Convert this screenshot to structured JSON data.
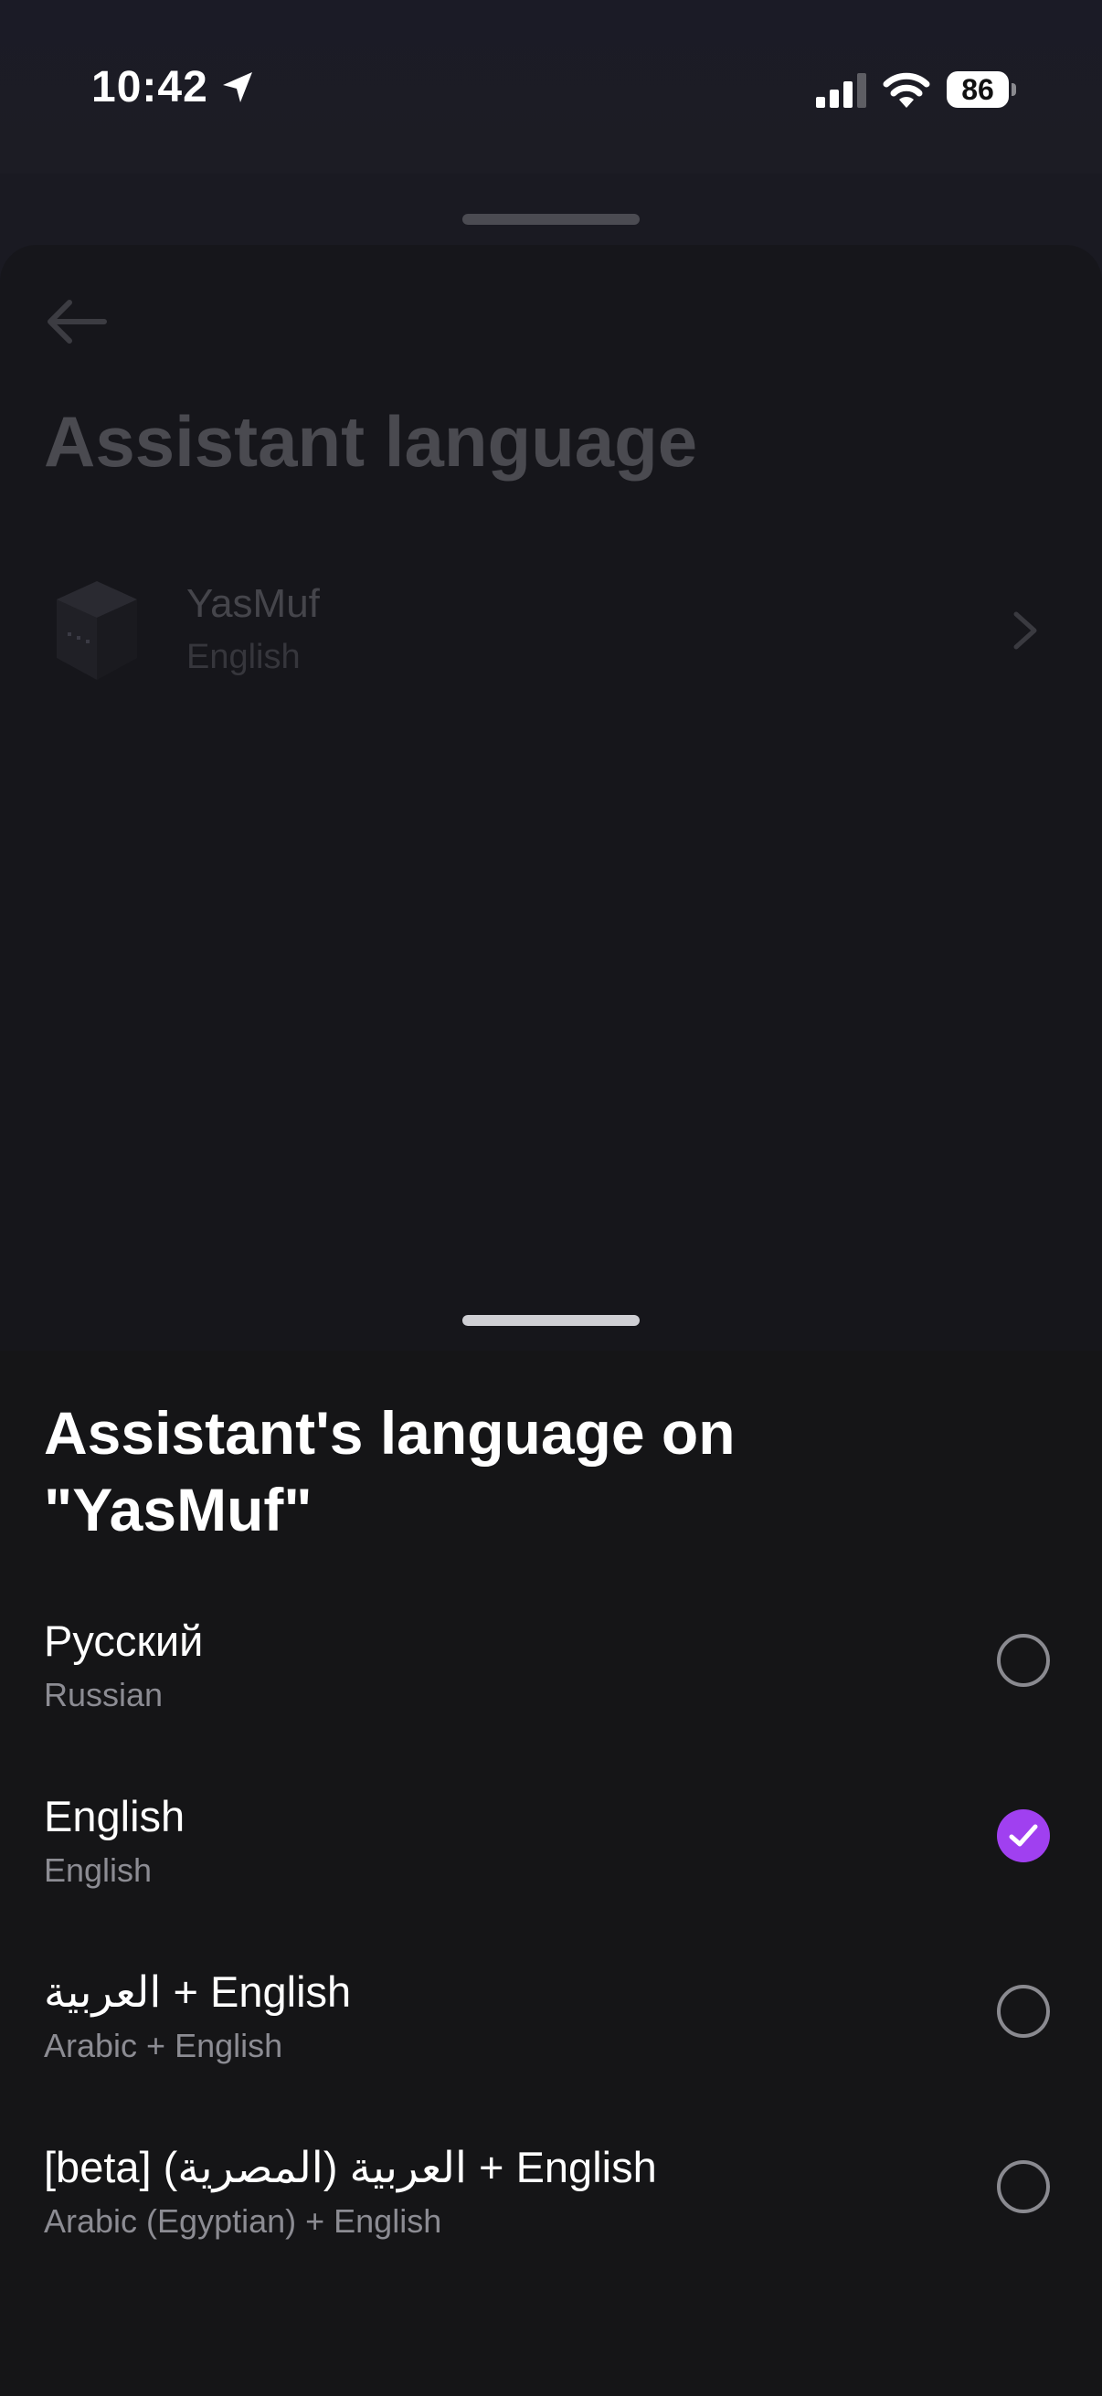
{
  "status_bar": {
    "time": "10:42",
    "battery": "86",
    "icons": [
      "location-arrow-icon",
      "cellular-signal-icon",
      "wifi-icon",
      "battery-icon"
    ]
  },
  "background_page": {
    "title": "Assistant language",
    "device": {
      "name": "YasMuf",
      "language": "English",
      "icon": "smart-speaker-icon"
    }
  },
  "sheet": {
    "title": "Assistant's language on \"YasMuf\"",
    "selected_index": 1,
    "accent_color": "#a040f0",
    "options": [
      {
        "label": "Русский",
        "sublabel": "Russian"
      },
      {
        "label": "العربية + English",
        "sublabel": "Arabic + English"
      },
      {
        "label": "English",
        "sublabel": "English"
      },
      {
        "label": "[beta] (العربية (المصرية + English",
        "sublabel": "Arabic (Egyptian) + English"
      }
    ]
  }
}
